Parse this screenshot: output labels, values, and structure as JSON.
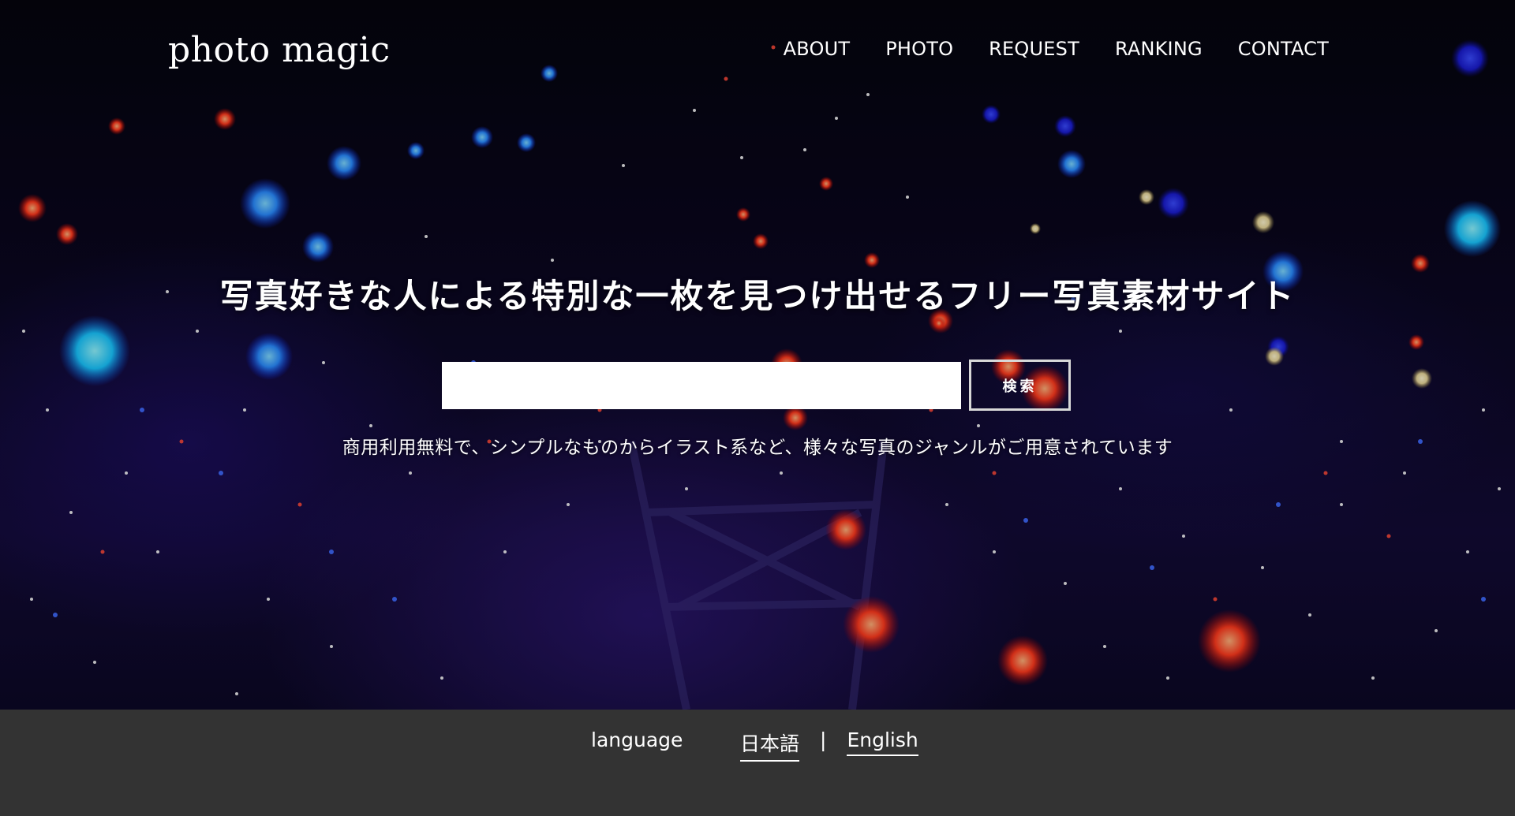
{
  "header": {
    "logo": "photo magic",
    "nav": [
      {
        "label": "ABOUT"
      },
      {
        "label": "PHOTO"
      },
      {
        "label": "REQUEST"
      },
      {
        "label": "RANKING"
      },
      {
        "label": "CONTACT"
      }
    ]
  },
  "hero": {
    "tagline": "写真好きな人による特別な一枚を見つけ出せるフリー写真素材サイト",
    "search": {
      "value": "",
      "button_label": "検索"
    },
    "subtext": "商用利用無料で、シンプルなものからイラスト系など、様々な写真のジャンルがご用意されています"
  },
  "footer": {
    "language_label": "language",
    "languages": [
      {
        "label": "日本語"
      },
      {
        "label": "English"
      }
    ],
    "separator": "|"
  },
  "colors": {
    "footer_bg": "#333333",
    "text": "#ffffff",
    "search_button_border": "#d8d8d8"
  }
}
